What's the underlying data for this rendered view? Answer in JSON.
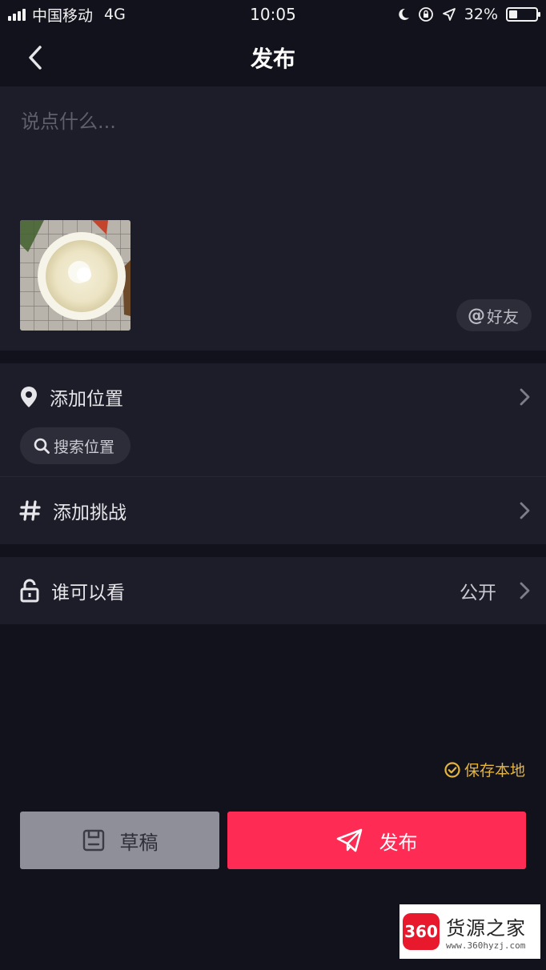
{
  "status_bar": {
    "carrier": "中国移动",
    "network": "4G",
    "time": "10:05",
    "battery": "32%",
    "battery_level": 0.32
  },
  "nav": {
    "title": "发布"
  },
  "compose": {
    "placeholder": "说点什么...",
    "mention_label": "好友",
    "mention_prefix": "@"
  },
  "options": {
    "location_label": "添加位置",
    "search_location": "搜索位置",
    "challenge_label": "添加挑战",
    "privacy_label": "谁可以看",
    "privacy_value": "公开"
  },
  "actions": {
    "save_local": "保存本地",
    "draft": "草稿",
    "publish": "发布"
  },
  "watermark": {
    "logo": "360",
    "name": "货源之家",
    "url": "www.360hyzj.com"
  },
  "colors": {
    "background": "#12121d",
    "card": "#1c1d28",
    "accent": "#fe2c55",
    "save_local": "#e4b43c",
    "draft_button": "#8e8f98"
  }
}
